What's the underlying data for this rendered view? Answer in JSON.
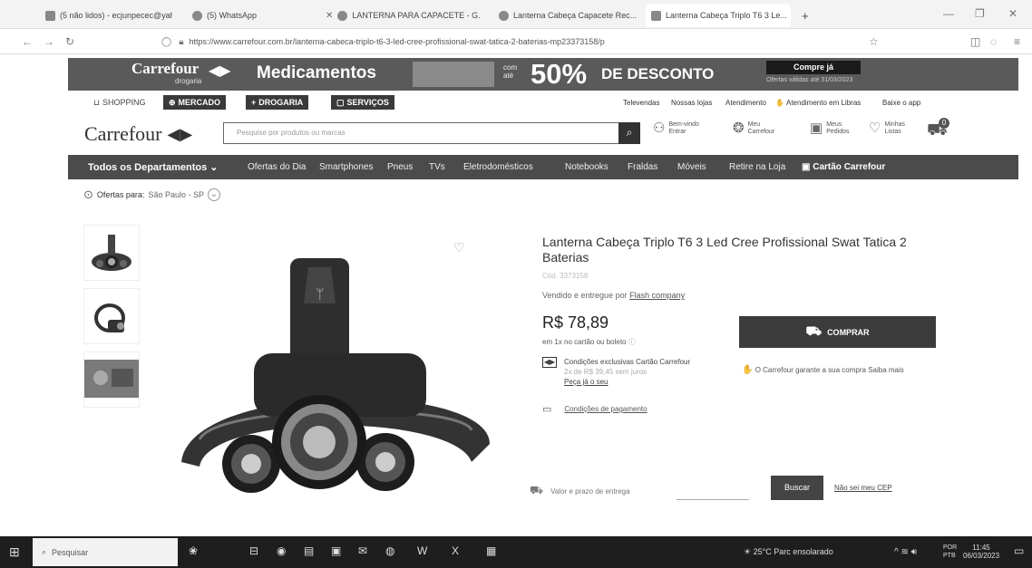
{
  "browser": {
    "tabs": [
      {
        "label": "(5 não lidos) - ecjunpecec@yah...",
        "icon": "mail-icon"
      },
      {
        "label": "(5) WhatsApp",
        "icon": "whatsapp-icon"
      },
      {
        "label": "LANTERNA PARA CAPACETE - G...",
        "icon": "google-icon"
      },
      {
        "label": "Lanterna Cabeça Capacete Rec...",
        "icon": "google-icon"
      },
      {
        "label": "Lanterna Cabeça Triplo T6 3 Le...",
        "icon": "carrefour-icon"
      }
    ],
    "new_tab": "+",
    "url": "https://www.carrefour.com.br/lanterna-cabeca-triplo-t6-3-led-cree-profissional-swat-tatica-2-baterias-mp23373158/p"
  },
  "promo": {
    "brand": "Carrefour",
    "brand_sub": "drogaria",
    "headline": "Medicamentos",
    "com_ate": "com até",
    "percent": "50%",
    "discount": "DE DESCONTO",
    "cta": "Compre já",
    "small_print": "Ofertas válidas até 31/03/2023"
  },
  "toplinks": {
    "shopping": "SHOPPING",
    "mercado": "MERCADO",
    "drogaria": "DROGARIA",
    "servicos": "SERVIÇOS",
    "util": [
      "Televendas",
      "Nossas lojas",
      "Atendimento",
      "Atendimento em Libras",
      "Baixe o app"
    ]
  },
  "header": {
    "logo": "Carrefour",
    "search_placeholder": "Pesquise por produtos ou marcas",
    "links": [
      {
        "l1": "Bem-vindo",
        "l2": "Entrar"
      },
      {
        "l1": "Meu",
        "l2": "Carrefour"
      },
      {
        "l1": "Meus",
        "l2": "Pedidos"
      },
      {
        "l1": "Minhas",
        "l2": "Listas"
      }
    ],
    "cart_count": "0"
  },
  "departments": {
    "all": "Todos os Departamentos",
    "items": [
      "Ofertas do Dia",
      "Smartphones",
      "Pneus",
      "TVs",
      "Eletrodomésticos",
      "Notebooks",
      "Fraldas",
      "Móveis",
      "Retire na Loja"
    ],
    "card": "Cartão Carrefour"
  },
  "offers": {
    "label": "Ofertas para:",
    "location": "São Paulo - SP"
  },
  "product": {
    "title": "Lanterna Cabeça Triplo T6 3 Led Cree Profissional Swat Tatica 2 Baterias",
    "code": "Cód. 3373158",
    "seller_prefix": "Vendido e entregue por",
    "seller": "Flash company",
    "price": "R$ 78,89",
    "installment": "em 1x no cartão ou boleto",
    "buy": "COMPRAR",
    "card_line1": "Condições exclusivas Cartão Carrefour",
    "card_line2": "2x de R$ 39,45 sem juros",
    "card_link": "Peça já o seu",
    "guarantee": "O Carrefour garante a sua compra Saiba mais",
    "payment": "Condições de pagamento",
    "cep_label": "Valor e prazo de entrega",
    "cep_button": "Buscar",
    "cep_link": "Não sei meu CEP"
  },
  "taskbar": {
    "search": "Pesquisar",
    "weather": "25°C  Parc ensolarado",
    "lang1": "POR",
    "lang2": "PTB",
    "time": "11:45",
    "date": "06/03/2023"
  }
}
